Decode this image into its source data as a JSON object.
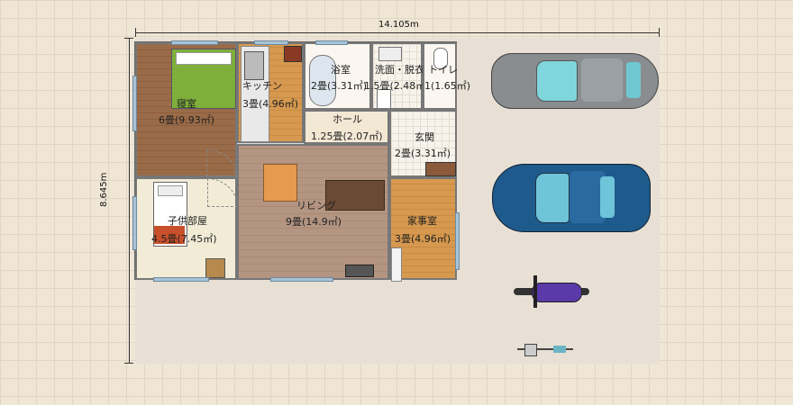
{
  "dimensions": {
    "width": "14.105m",
    "height": "8.645m"
  },
  "rooms": [
    {
      "name": "寝室",
      "area": "6畳(9.93㎡)"
    },
    {
      "name": "キッチン",
      "area": "3畳(4.96㎡)"
    },
    {
      "name": "浴室",
      "area": "2畳(3.31㎡)"
    },
    {
      "name": "洗面・脱衣",
      "area": "1.5畳(2.48㎡)"
    },
    {
      "name": "トイレ",
      "area": "1(1.65㎡)"
    },
    {
      "name": "ホール",
      "area": "1.25畳(2.07㎡)"
    },
    {
      "name": "玄関",
      "area": "2畳(3.31㎡)"
    },
    {
      "name": "子供部屋",
      "area": "4.5畳(7.45㎡)"
    },
    {
      "name": "リビング",
      "area": "9畳(14.9㎡)"
    },
    {
      "name": "家事室",
      "area": "3畳(4.96㎡)"
    }
  ],
  "vehicles": [
    "silver-car-icon",
    "blue-car-icon",
    "motorcycle-icon",
    "bicycle-icon"
  ],
  "colors": {
    "bedroom_floor": "#9a6b48",
    "living_floor": "#b49582",
    "work_floor": "#d6994f",
    "car_blue": "#1f5a8c",
    "car_silver": "#8a8d90",
    "bike_purple": "#5a3aa8"
  }
}
